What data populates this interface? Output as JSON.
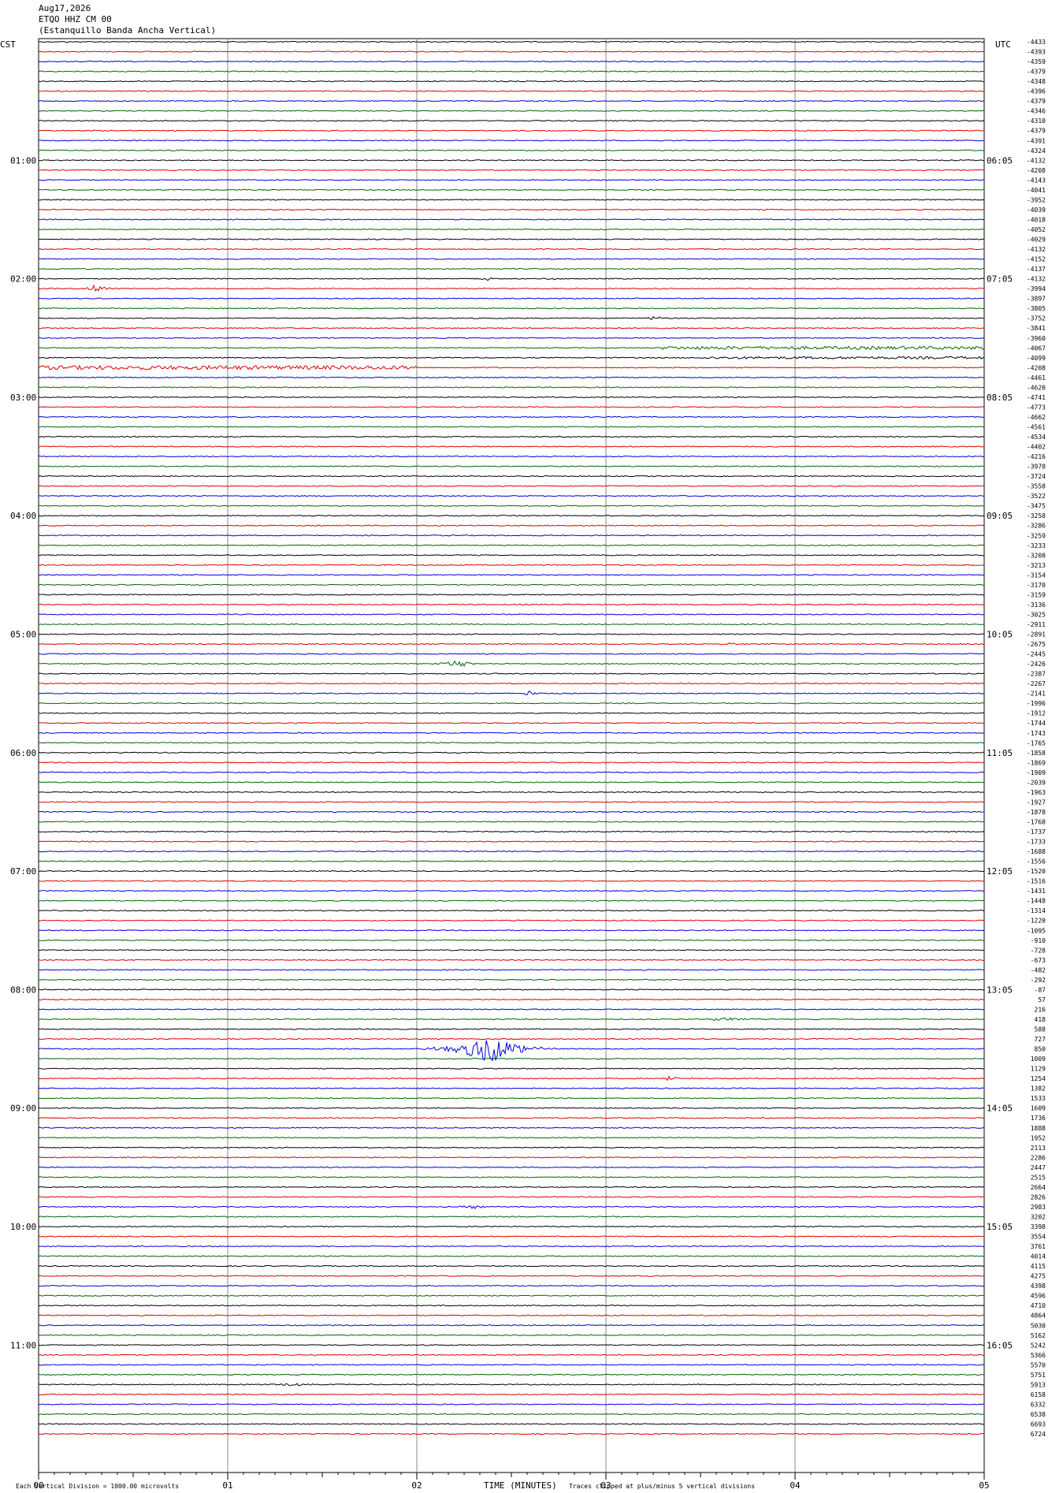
{
  "header": {
    "date": "Aug17,2026",
    "station": "ETQO HHZ CM 00",
    "name": "(Estanquillo Banda Ancha Vertical)"
  },
  "chart_data": {
    "type": "line",
    "left_zone": "CST",
    "right_zone": "UTC",
    "xlabel": "TIME (MINUTES)",
    "x_ticks": [
      "00",
      "01",
      "02",
      "03",
      "04",
      "05"
    ],
    "xlim": [
      0,
      5
    ],
    "left_hour_labels": [
      "01:00",
      "02:00",
      "03:00",
      "04:00",
      "05:00",
      "06:00",
      "07:00",
      "08:00",
      "09:00",
      "10:00",
      "11:00"
    ],
    "right_hour_labels": [
      "06:05",
      "07:05",
      "08:05",
      "09:05",
      "10:05",
      "11:05",
      "12:05",
      "13:05",
      "14:05",
      "15:05",
      "16:05"
    ],
    "trace_colors": [
      "#000000",
      "#dd0000",
      "#0000dd",
      "#006600"
    ],
    "trace_offsets": [
      -4433,
      -4393,
      -4359,
      -4379,
      -4348,
      -4396,
      -4379,
      -4346,
      -4310,
      -4379,
      -4391,
      -4324,
      -4132,
      -4208,
      -4143,
      -4041,
      -3952,
      -4039,
      -4018,
      -4052,
      -4029,
      -4132,
      -4152,
      -4137,
      -4132,
      -3994,
      -3897,
      -3805,
      -3752,
      -3841,
      -3960,
      -4067,
      -4099,
      -4208,
      -4461,
      -4620,
      -4741,
      -4773,
      -4662,
      -4561,
      -4534,
      -4402,
      -4216,
      -3978,
      -3724,
      -3558,
      -3522,
      -3475,
      -3258,
      -3286,
      -3259,
      -3233,
      -3208,
      -3213,
      -3154,
      -3170,
      -3159,
      -3136,
      -3025,
      -2911,
      -2891,
      -2675,
      -2445,
      -2426,
      -2387,
      -2267,
      -2141,
      -1996,
      -1912,
      -1744,
      -1743,
      -1765,
      -1858,
      -1869,
      -1909,
      -2039,
      -1963,
      -1927,
      -1878,
      -1768,
      -1737,
      -1733,
      -1688,
      -1556,
      -1520,
      -1516,
      -1431,
      -1448,
      -1314,
      -1220,
      -1095,
      -910,
      -728,
      -673,
      -482,
      -292,
      -87,
      57,
      216,
      418,
      588,
      727,
      850,
      1009,
      1129,
      1254,
      1382,
      1533,
      1609,
      1736,
      1888,
      1952,
      2113,
      2286,
      2447,
      2515,
      2664,
      2826,
      2983,
      3202,
      3398,
      3554,
      3761,
      4014,
      4115,
      4275,
      4398,
      4596,
      4710,
      4864,
      5030,
      5162,
      5242,
      5366,
      5570,
      5751,
      5913,
      6158,
      6332,
      6538,
      6693,
      6724
    ],
    "events": [
      {
        "trace": 25,
        "minute": 0.3,
        "amplitude": 8,
        "width": 0.03
      },
      {
        "trace": 24,
        "minute": 2.37,
        "amplitude": 2,
        "width": 0.03
      },
      {
        "trace": 24,
        "minute": 2.72,
        "amplitude": 2,
        "width": 0.02
      },
      {
        "trace": 28,
        "minute": 3.25,
        "amplitude": 3,
        "width": 0.03
      },
      {
        "trace": 63,
        "minute": 2.21,
        "amplitude": 6,
        "width": 0.05
      },
      {
        "trace": 66,
        "minute": 2.6,
        "amplitude": 3,
        "width": 0.04
      },
      {
        "trace": 61,
        "minute": 3.65,
        "amplitude": 2,
        "width": 0.03
      },
      {
        "trace": 102,
        "minute": 2.38,
        "amplitude": 20,
        "width": 0.12
      },
      {
        "trace": 105,
        "minute": 3.34,
        "amplitude": 4,
        "width": 0.03
      },
      {
        "trace": 99,
        "minute": 3.65,
        "amplitude": 2,
        "width": 0.1
      },
      {
        "trace": 118,
        "minute": 2.3,
        "amplitude": 2,
        "width": 0.05
      },
      {
        "trace": 136,
        "minute": 1.35,
        "amplitude": 2,
        "width": 0.08
      }
    ],
    "noisy_segments": [
      {
        "trace": 33,
        "from": 0.0,
        "to": 2.0,
        "amplitude": 2.5
      },
      {
        "trace": 31,
        "from": 3.3,
        "to": 5.0,
        "amplitude": 2.0
      },
      {
        "trace": 32,
        "from": 3.5,
        "to": 5.0,
        "amplitude": 1.5
      }
    ],
    "footer_note_left": "Each Vertical Division = 1000.00 microvolts",
    "footer_note_right": "Traces clipped at plus/minus 5 vertical divisions"
  }
}
